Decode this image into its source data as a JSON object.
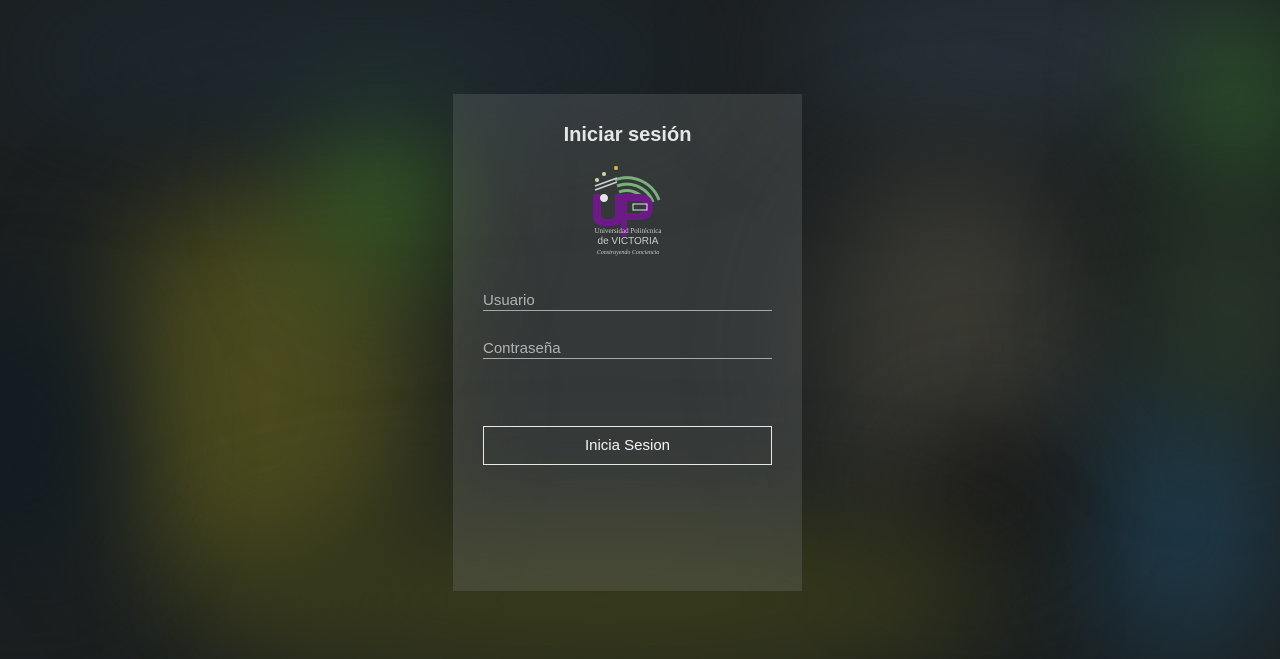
{
  "login": {
    "title": "Iniciar sesión",
    "username_placeholder": "Usuario",
    "password_placeholder": "Contraseña",
    "submit_label": "Inicia Sesion"
  },
  "logo": {
    "letters": "UP",
    "line1": "Universidad Politécnica",
    "line2": "de VICTORIA",
    "tagline": "Construyendo Conciencia",
    "brand_color": "#6b1a86",
    "accent_color": "#7ab07a"
  }
}
